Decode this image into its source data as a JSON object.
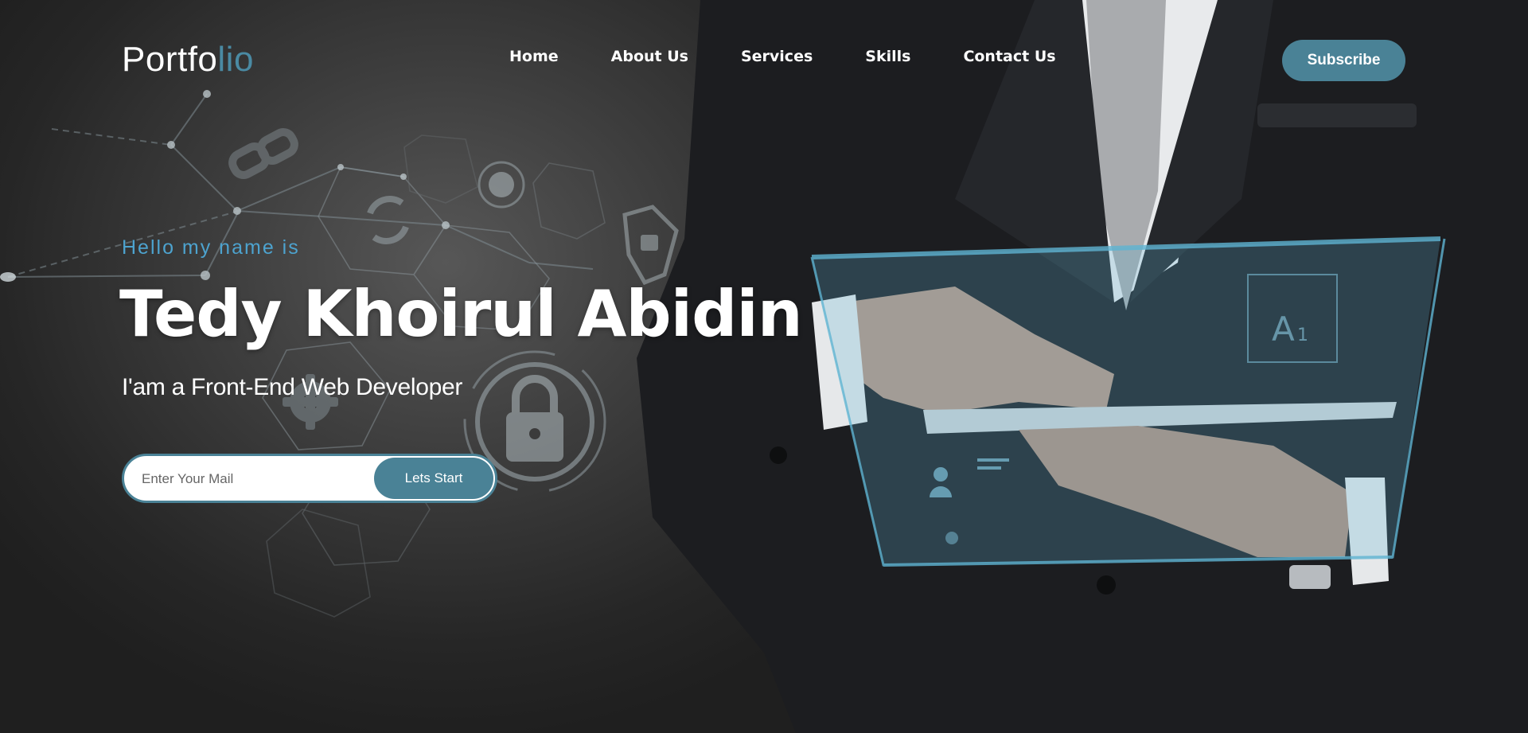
{
  "header": {
    "logo_main": "Portfo",
    "logo_accent": "lio",
    "nav": [
      "Home",
      "About Us",
      "Services",
      "Skills",
      "Contact Us"
    ],
    "subscribe_label": "Subscribe"
  },
  "hero": {
    "greeting": "Hello my name is",
    "name": "Tedy Khoirul Abidin",
    "role": "I'am a Front-End Web Developer",
    "email_placeholder": "Enter Your Mail",
    "cta_label": "Lets Start"
  },
  "colors": {
    "accent": "#4a8296",
    "greeting": "#4da3cf",
    "background": "#2b2b2b",
    "text": "#ffffff"
  }
}
